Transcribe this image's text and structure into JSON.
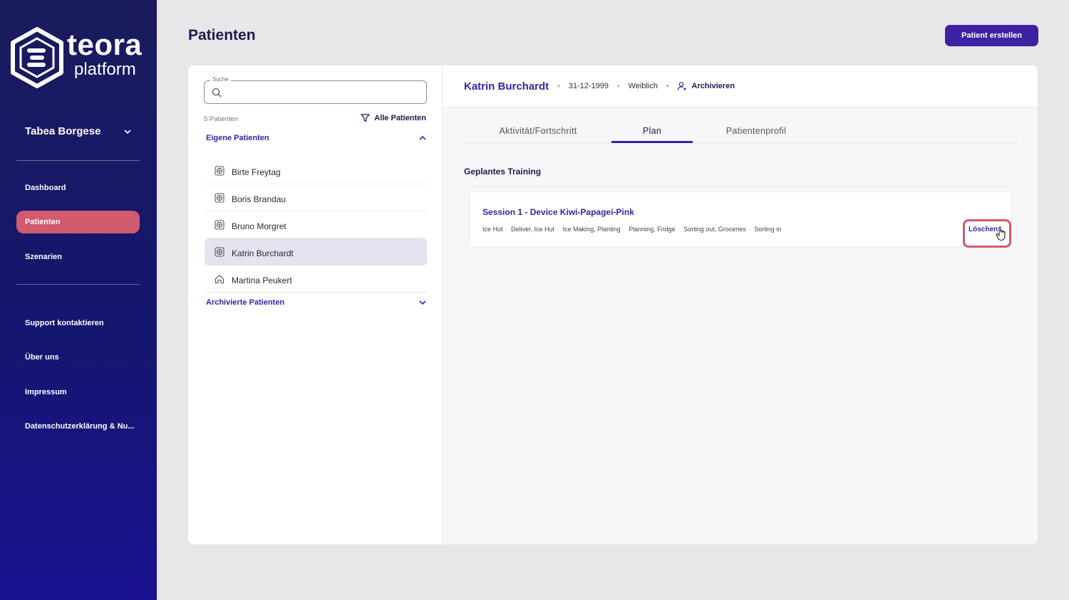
{
  "brand": {
    "name": "teora",
    "subtitle": "platform"
  },
  "user": {
    "name": "Tabea Borgese"
  },
  "nav": {
    "items": [
      {
        "label": "Dashboard",
        "active": false
      },
      {
        "label": "Patienten",
        "active": true
      },
      {
        "label": "Szenarien",
        "active": false
      }
    ],
    "secondary": [
      {
        "label": "Support kontaktieren"
      },
      {
        "label": "Über uns"
      },
      {
        "label": "Impressum"
      },
      {
        "label": "Datenschutzerklärung & Nu..."
      }
    ]
  },
  "header": {
    "title": "Patienten",
    "create_button": "Patient erstellen"
  },
  "patient_list": {
    "search_label": "Suche",
    "search_value": "",
    "count": "5 Patienten",
    "filter_label": "Alle Patienten",
    "own_section": "Eigene Patienten",
    "archived_section": "Archivierte Patienten",
    "patients": [
      {
        "name": "Birte Freytag",
        "icon": "device-icon",
        "selected": false
      },
      {
        "name": "Boris Brandau",
        "icon": "device-icon",
        "selected": false
      },
      {
        "name": "Bruno Morgret",
        "icon": "device-icon",
        "selected": false
      },
      {
        "name": "Katrin Burchardt",
        "icon": "device-icon",
        "selected": true
      },
      {
        "name": "Martina Peukert",
        "icon": "home-icon",
        "selected": false
      }
    ]
  },
  "detail": {
    "name": "Katrin Burchardt",
    "birthdate": "31-12-1999",
    "gender": "Weiblich",
    "archive_label": "Archivieren",
    "tabs": [
      {
        "label": "Aktivität/Fortschritt",
        "active": false
      },
      {
        "label": "Plan",
        "active": true
      },
      {
        "label": "Patientenprofil",
        "active": false
      }
    ],
    "section_title": "Geplantes Training",
    "session": {
      "title": "Session 1 - Device Kiwi-Papagei-Pink",
      "tags": [
        "Ice Hut",
        "Deliver, Ice Hut",
        "Ice Making, Planting",
        "Planning, Fridge",
        "Sorting out, Groceries",
        "Sorting in"
      ],
      "delete_label": "Löschen"
    }
  },
  "colors": {
    "sidebar": "#15166f",
    "accent": "#3c22a3",
    "active_nav": "#d25a6e",
    "highlight": "#d25a6e"
  }
}
